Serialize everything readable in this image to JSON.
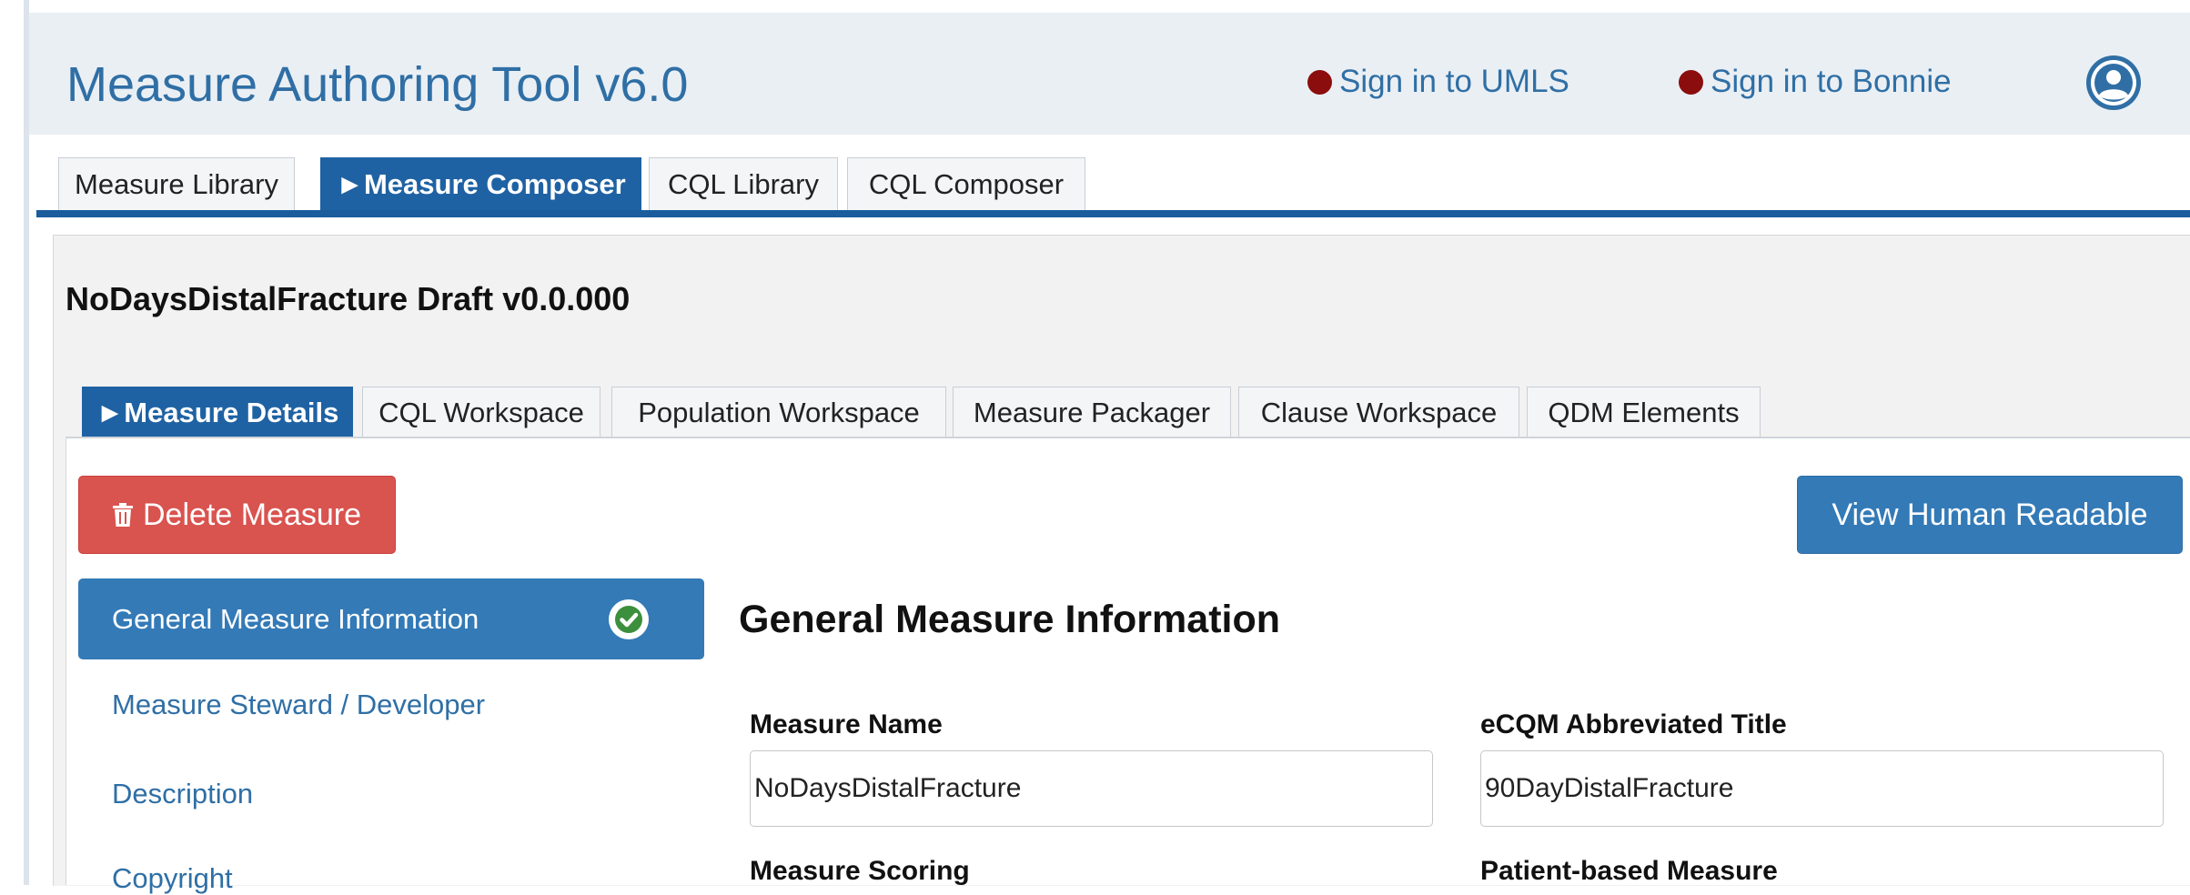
{
  "app": {
    "title": "Measure Authoring Tool v6.0",
    "signin_umls": "Sign in to UMLS",
    "signin_bonnie": "Sign in to Bonnie",
    "status_color": "#8b0d0d",
    "accent_color": "#1f62a3"
  },
  "main_tabs": [
    {
      "label": "Measure Library",
      "active": false
    },
    {
      "label": "►Measure Composer",
      "active": true
    },
    {
      "label": "CQL Library",
      "active": false
    },
    {
      "label": "CQL Composer",
      "active": false
    }
  ],
  "measure": {
    "title": "NoDaysDistalFracture Draft v0.0.000"
  },
  "sub_tabs": [
    {
      "label": "►Measure Details",
      "active": true
    },
    {
      "label": "CQL Workspace",
      "active": false
    },
    {
      "label": "Population Workspace",
      "active": false
    },
    {
      "label": "Measure Packager",
      "active": false
    },
    {
      "label": "Clause Workspace",
      "active": false
    },
    {
      "label": "QDM Elements",
      "active": false
    }
  ],
  "actions": {
    "delete_label": "Delete Measure",
    "delete_icon": "trash-icon",
    "view_label": "View Human Readable"
  },
  "sidebar": {
    "items": [
      {
        "label": "General Measure Information",
        "active": true,
        "icon": "check-circle-icon"
      },
      {
        "label": "Measure Steward / Developer",
        "active": false
      },
      {
        "label": "Description",
        "active": false
      },
      {
        "label": "Copyright",
        "active": false
      }
    ]
  },
  "form": {
    "section_title": "General Measure Information",
    "measure_name_label": "Measure Name",
    "measure_name_value": "NoDaysDistalFracture",
    "abbreviated_title_label": "eCQM Abbreviated Title",
    "abbreviated_title_value": "90DayDistalFracture",
    "scoring_label": "Measure Scoring",
    "patient_based_label": "Patient-based Measure"
  }
}
